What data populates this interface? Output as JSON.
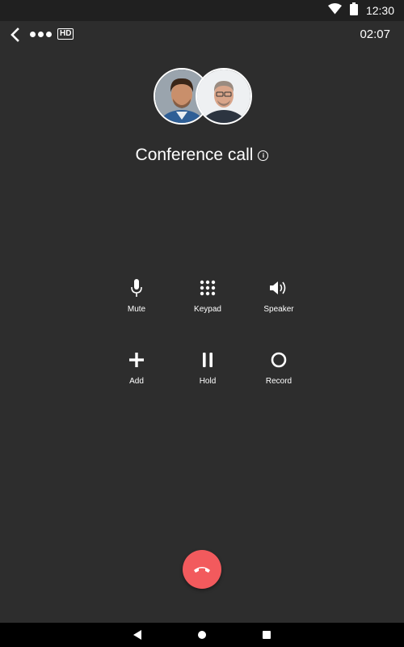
{
  "status_bar": {
    "time": "12:30",
    "icons": [
      "wifi-icon",
      "battery-icon"
    ]
  },
  "call_header": {
    "hd_label": "HD",
    "timer": "02:07"
  },
  "participants": [
    {
      "name": "participant-1"
    },
    {
      "name": "participant-2"
    }
  ],
  "call": {
    "title": "Conference call",
    "info_glyph": "i"
  },
  "controls": {
    "row1": [
      {
        "label": "Mute",
        "icon": "microphone-icon"
      },
      {
        "label": "Keypad",
        "icon": "keypad-icon"
      },
      {
        "label": "Speaker",
        "icon": "speaker-icon"
      }
    ],
    "row2": [
      {
        "label": "Add",
        "icon": "plus-icon"
      },
      {
        "label": "Hold",
        "icon": "pause-icon"
      },
      {
        "label": "Record",
        "icon": "record-icon"
      }
    ]
  },
  "colors": {
    "background": "#2d2d2d",
    "end_call": "#f25a5d",
    "status_bar": "#202020",
    "nav_bar": "#000000"
  },
  "navigation": {
    "icons": [
      "back-triangle-icon",
      "home-circle-icon",
      "recents-square-icon"
    ]
  }
}
